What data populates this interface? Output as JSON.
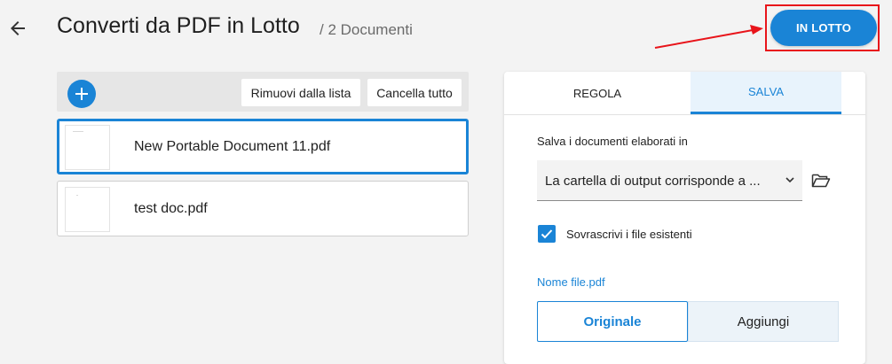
{
  "header": {
    "title": "Converti da PDF in Lotto",
    "subtitle": "/ 2 Documenti",
    "batch_button_label": "IN LOTTO",
    "back_icon": "arrow-left-icon"
  },
  "toolbar": {
    "add_icon": "plus-icon",
    "remove_label": "Rimuovi dalla lista",
    "clear_label": "Cancella tutto"
  },
  "files": [
    {
      "name": "New Portable Document 11.pdf",
      "selected": true
    },
    {
      "name": "test doc.pdf",
      "selected": false
    }
  ],
  "panel": {
    "tabs": [
      {
        "label": "REGOLA",
        "active": false
      },
      {
        "label": "SALVA",
        "active": true
      }
    ],
    "save_label": "Salva i documenti elaborati in",
    "output_dropdown_value": "La cartella di output corrisponde a ...",
    "folder_icon": "folder-open-icon",
    "overwrite_checked": true,
    "overwrite_label": "Sovrascrivi i file esistenti",
    "filename_link": "Nome file.pdf",
    "filename_options": [
      {
        "label": "Originale",
        "selected": true
      },
      {
        "label": "Aggiungi",
        "selected": false
      }
    ]
  },
  "colors": {
    "accent": "#1a84d6",
    "highlight": "#e8141a",
    "background": "#f3f3f3"
  }
}
